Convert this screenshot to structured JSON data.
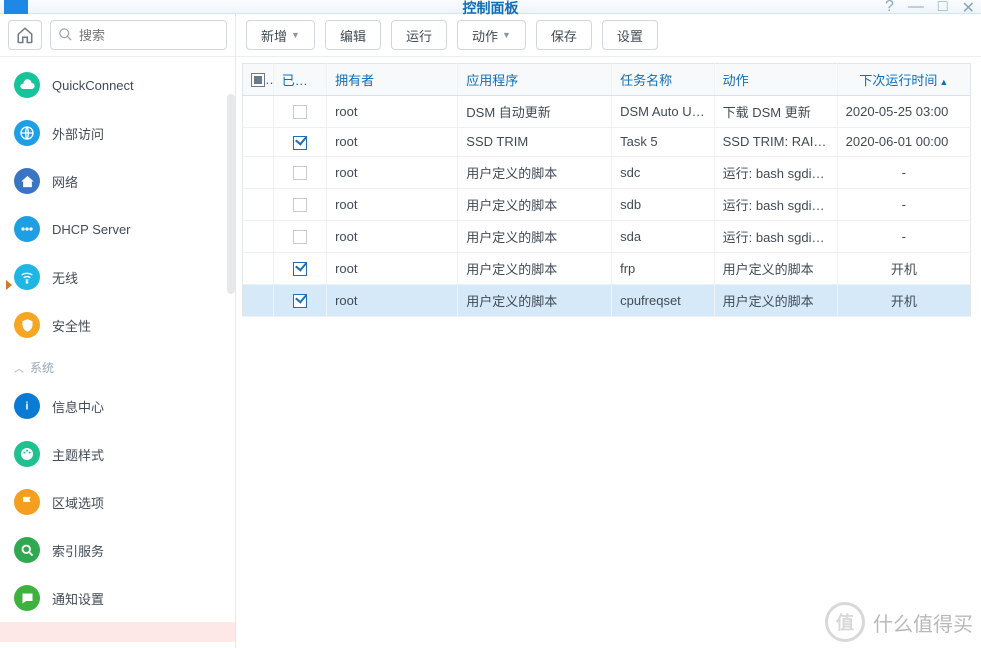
{
  "window": {
    "title": "控制面板"
  },
  "search": {
    "placeholder": "搜索"
  },
  "sidebar": {
    "section_label": "系统",
    "items_top": [
      {
        "label": "QuickConnect",
        "color": "#16c39a",
        "icon": "cloud"
      },
      {
        "label": "外部访问",
        "color": "#1f9fe3",
        "icon": "globe"
      },
      {
        "label": "网络",
        "color": "#3a74c4",
        "icon": "house"
      },
      {
        "label": "DHCP Server",
        "color": "#1f9fe3",
        "icon": "dots"
      },
      {
        "label": "无线",
        "color": "#1fb6e3",
        "icon": "wifi"
      },
      {
        "label": "安全性",
        "color": "#f5a623",
        "icon": "shield"
      }
    ],
    "items_system": [
      {
        "label": "信息中心",
        "color": "#0a7bd4",
        "icon": "info"
      },
      {
        "label": "主题样式",
        "color": "#1fc18f",
        "icon": "palette"
      },
      {
        "label": "区域选项",
        "color": "#f59e1f",
        "icon": "flag"
      },
      {
        "label": "索引服务",
        "color": "#2fa84f",
        "icon": "search"
      },
      {
        "label": "通知设置",
        "color": "#3fb13f",
        "icon": "chat"
      }
    ]
  },
  "toolbar": {
    "new": "新增",
    "edit": "编辑",
    "run": "运行",
    "action": "动作",
    "save": "保存",
    "settings": "设置"
  },
  "columns": {
    "enabled": "已启动",
    "owner": "拥有者",
    "app": "应用程序",
    "task": "任务名称",
    "action": "动作",
    "next": "下次运行时间"
  },
  "rows": [
    {
      "enabled": false,
      "owner": "root",
      "app": "DSM 自动更新",
      "task": "DSM Auto Update",
      "action": "下载 DSM 更新",
      "next": "2020-05-25 03:00",
      "center_next": false
    },
    {
      "enabled": true,
      "owner": "root",
      "app": "SSD TRIM",
      "task": "Task 5",
      "action": "SSD TRIM: RAID ...",
      "next": "2020-06-01 00:00",
      "center_next": false
    },
    {
      "enabled": false,
      "owner": "root",
      "app": "用户定义的脚本",
      "task": "sdc",
      "action": "运行: bash sgdis...",
      "next": "-",
      "center_next": true
    },
    {
      "enabled": false,
      "owner": "root",
      "app": "用户定义的脚本",
      "task": "sdb",
      "action": "运行: bash sgdis...",
      "next": "-",
      "center_next": true
    },
    {
      "enabled": false,
      "owner": "root",
      "app": "用户定义的脚本",
      "task": "sda",
      "action": "运行: bash sgdis...",
      "next": "-",
      "center_next": true
    },
    {
      "enabled": true,
      "owner": "root",
      "app": "用户定义的脚本",
      "task": "frp",
      "action": "用户定义的脚本",
      "next": "开机",
      "center_next": true
    },
    {
      "enabled": true,
      "owner": "root",
      "app": "用户定义的脚本",
      "task": "cpufreqset",
      "action": "用户定义的脚本",
      "next": "开机",
      "center_next": true,
      "selected": true,
      "marker": true
    }
  ],
  "watermark": {
    "badge": "值",
    "text": "什么值得买"
  }
}
